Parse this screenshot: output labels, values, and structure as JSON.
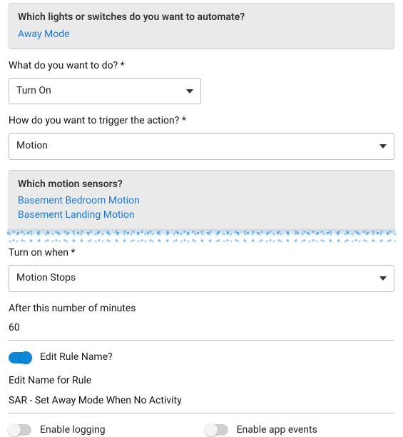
{
  "lights_panel": {
    "title": "Which lights or switches do you want to automate?",
    "selected": [
      "Away Mode"
    ]
  },
  "action": {
    "label": "What do you want to do? *",
    "value": "Turn On"
  },
  "trigger": {
    "label": "How do you want to trigger the action? *",
    "value": "Motion"
  },
  "motion_panel": {
    "title": "Which motion sensors?",
    "selected": [
      "Basement Bedroom Motion",
      "Basement Landing Motion"
    ]
  },
  "turn_on_when": {
    "label": "Turn on when *",
    "value": "Motion Stops"
  },
  "minutes": {
    "label": "After this number of minutes",
    "value": "60"
  },
  "edit_name_toggle": {
    "label": "Edit Rule Name?",
    "on": true
  },
  "rule_name": {
    "label": "Edit Name for Rule",
    "value": "SAR - Set Away Mode When No Activity"
  },
  "enable_logging": {
    "label": "Enable logging",
    "on": false
  },
  "enable_app_events": {
    "label": "Enable app events",
    "on": false
  }
}
